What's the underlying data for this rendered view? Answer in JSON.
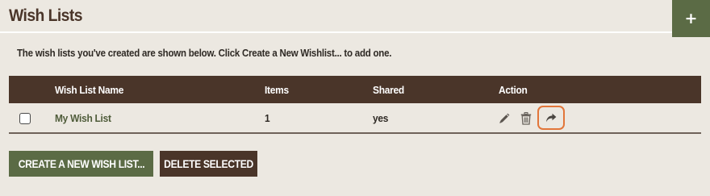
{
  "header": {
    "title": "Wish Lists",
    "add_label": "+"
  },
  "intro_text": "The wish lists you've created are shown below. Click Create a New Wishlist... to add one.",
  "table": {
    "columns": {
      "name": "Wish List Name",
      "items": "Items",
      "shared": "Shared",
      "action": "Action"
    },
    "rows": [
      {
        "checked": false,
        "name": "My Wish List",
        "items": "1",
        "shared": "yes",
        "actions": [
          "pencil-icon",
          "trash-icon",
          "share-arrow-icon"
        ]
      }
    ]
  },
  "buttons": {
    "create": "CREATE A NEW WISH LIST...",
    "delete": "DELETE SELECTED"
  },
  "colors": {
    "background": "#ece8e1",
    "brown": "#4a3529",
    "olive": "#5b6b45",
    "highlight": "#e2763a"
  }
}
